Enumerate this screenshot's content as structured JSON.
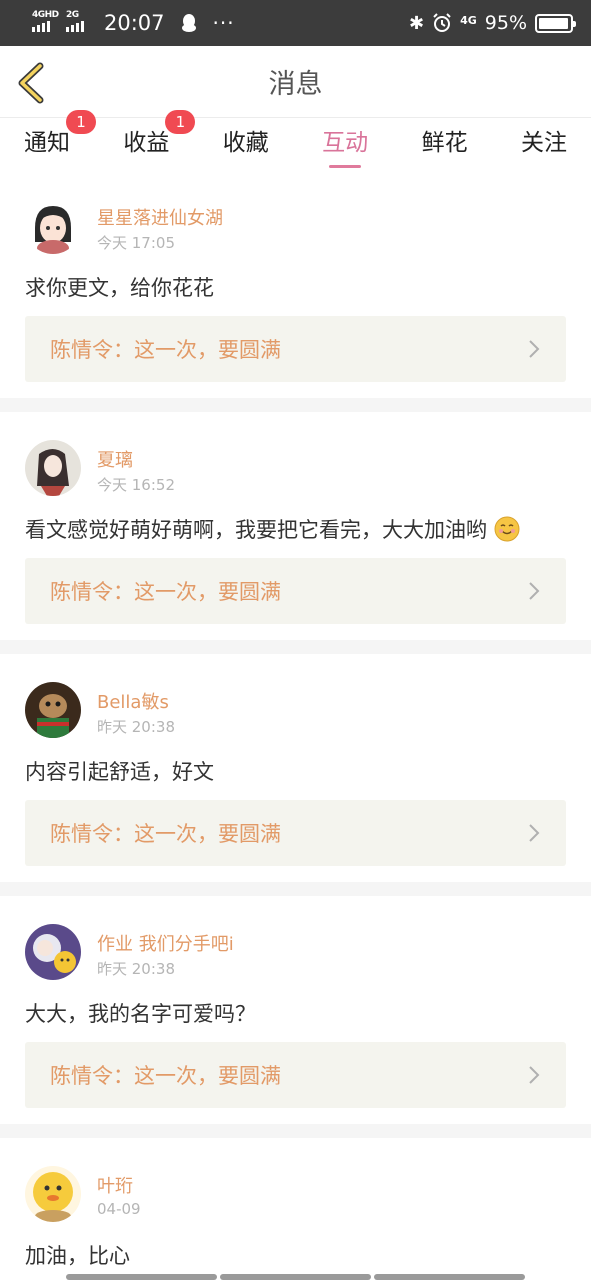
{
  "status": {
    "net1": "4GHD",
    "net2": "2G",
    "time": "20:07",
    "dots": "···",
    "net3": "4G",
    "battery": "95%",
    "battery_level": 0.95
  },
  "nav": {
    "title": "消息"
  },
  "tabs": [
    {
      "label": "通知",
      "badge": "1"
    },
    {
      "label": "收益",
      "badge": "1"
    },
    {
      "label": "收藏"
    },
    {
      "label": "互动",
      "active": true
    },
    {
      "label": "鲜花"
    },
    {
      "label": "关注"
    }
  ],
  "feed": [
    {
      "user": "星星落进仙女湖",
      "time": "今天 17:05",
      "text": "求你更文，给你花花",
      "quote": "陈情令：这一次，要圆满"
    },
    {
      "user": "夏璃",
      "time": "今天 16:52",
      "text": "看文感觉好萌好萌啊，我要把它看完，大大加油哟",
      "quote": "陈情令：这一次，要圆满"
    },
    {
      "user": "Bella敏s",
      "time": "昨天 20:38",
      "text": "内容引起舒适，好文",
      "quote": "陈情令：这一次，要圆满"
    },
    {
      "user": "作业 我们分手吧i",
      "time": "昨天 20:38",
      "text": "大大，我的名字可爱吗？",
      "quote": "陈情令：这一次，要圆满"
    },
    {
      "user": "叶珩",
      "time": "04-09",
      "text": "加油，比心"
    }
  ],
  "colors": {
    "accent": "#e07a9c",
    "name": "#e29a67",
    "badge": "#f04a52"
  }
}
